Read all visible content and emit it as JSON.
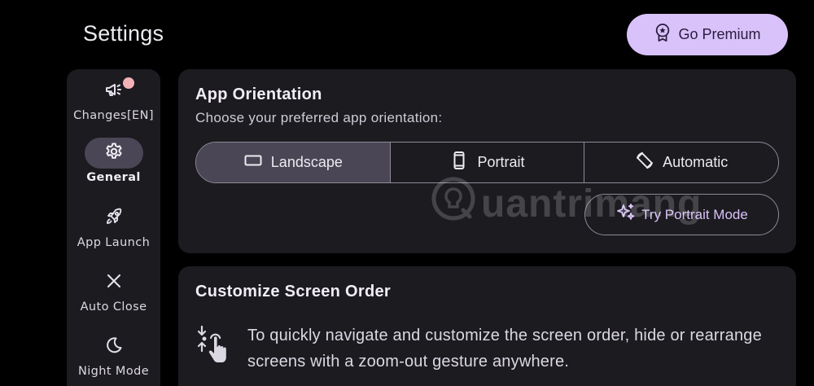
{
  "header": {
    "title": "Settings",
    "premium_label": "Go Premium"
  },
  "sidebar": {
    "items": [
      {
        "label": "Changes[EN]",
        "icon": "megaphone-icon",
        "active": false,
        "has_badge": true
      },
      {
        "label": "General",
        "icon": "gear-icon",
        "active": true
      },
      {
        "label": "App Launch",
        "icon": "rocket-icon",
        "active": false
      },
      {
        "label": "Auto Close",
        "icon": "close-icon",
        "active": false
      },
      {
        "label": "Night Mode",
        "icon": "moon-icon",
        "active": false
      }
    ]
  },
  "orientation": {
    "title": "App Orientation",
    "subtitle": "Choose your preferred app orientation:",
    "options": [
      {
        "label": "Landscape",
        "icon": "landscape-icon",
        "selected": true
      },
      {
        "label": "Portrait",
        "icon": "phone-portrait-icon",
        "selected": false
      },
      {
        "label": "Automatic",
        "icon": "screen-rotation-icon",
        "selected": false
      }
    ],
    "try_label": "Try Portrait Mode"
  },
  "screen_order": {
    "title": "Customize Screen Order",
    "description": "To quickly navigate and customize the screen order, hide or rearrange screens with a zoom-out gesture anywhere."
  },
  "watermark": {
    "text": "uantrimang"
  },
  "colors": {
    "background": "#000000",
    "surface": "#1c1b20",
    "accent": "#d9c2f9",
    "selected": "#4a4656",
    "badge": "#f2b3b7"
  }
}
